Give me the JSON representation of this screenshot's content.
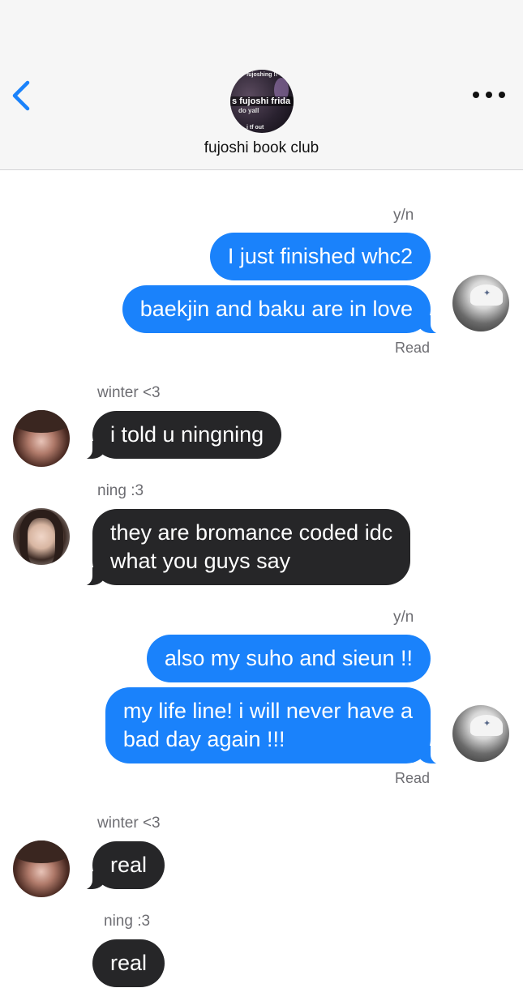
{
  "header": {
    "group_name": "fujoshi book club",
    "group_avatar_text": {
      "line1": "fujoshing !!",
      "line2": "s fujoshi frida",
      "line3": "do yall",
      "line4": "i tf out"
    }
  },
  "messages": {
    "g1": {
      "sender": "y/n",
      "b1": "I just finished whc2",
      "b2": "baekjin and baku are in love",
      "status": "Read"
    },
    "g2": {
      "sender": "winter <3",
      "b1": "i told u ningning"
    },
    "g3": {
      "sender": "ning :3",
      "b1_line1": "they are bromance coded idc",
      "b1_line2": "what you guys say"
    },
    "g4": {
      "sender": "y/n",
      "b1": "also my suho and sieun !!",
      "b2_line1": "my life line! i will never have a",
      "b2_line2": "bad day again !!!",
      "status": "Read"
    },
    "g5": {
      "sender": "winter <3",
      "b1": "real"
    },
    "g6": {
      "sender": "ning :3",
      "b1": "real"
    }
  },
  "colors": {
    "outgoing_bubble": "#1a82fb",
    "incoming_bubble": "#262628",
    "accent": "#1a82fb"
  },
  "icons": {
    "back": "chevron-left-icon",
    "more": "ellipsis-icon"
  }
}
